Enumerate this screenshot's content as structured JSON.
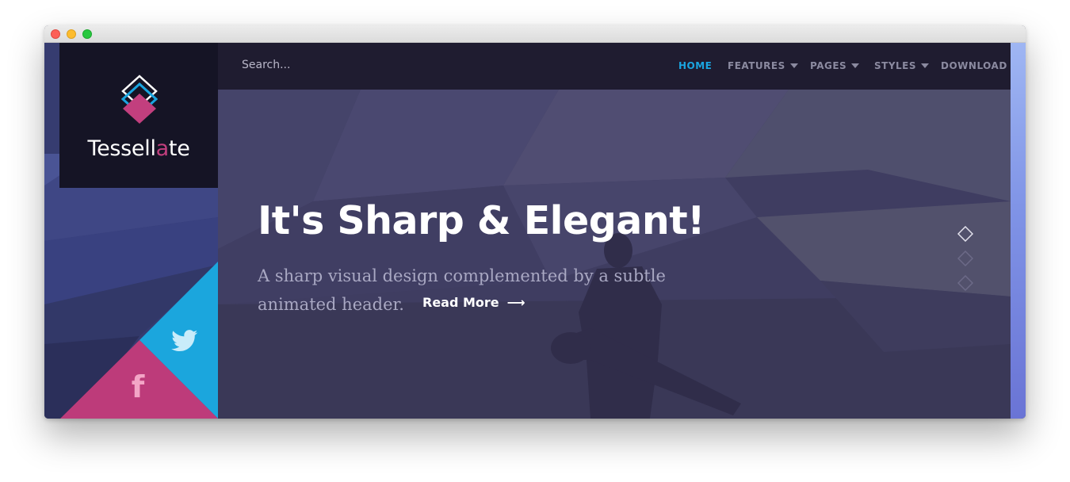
{
  "brand": {
    "name_part1": "Tessell",
    "name_accent": "a",
    "name_part2": "te",
    "accent_color": "#c23f7e"
  },
  "search": {
    "placeholder": "Search..."
  },
  "nav": {
    "items": [
      {
        "label": "HOME",
        "active": true,
        "dropdown": false
      },
      {
        "label": "FEATURES",
        "active": false,
        "dropdown": true
      },
      {
        "label": "PAGES",
        "active": false,
        "dropdown": true
      },
      {
        "label": "STYLES",
        "active": false,
        "dropdown": true
      },
      {
        "label": "DOWNLOAD",
        "active": false,
        "dropdown": false
      }
    ],
    "active_color": "#1aa5e0"
  },
  "hero": {
    "title": "It's Sharp & Elegant!",
    "subtitle_line1": "A sharp visual design complemented by a subtle",
    "subtitle_line2": "animated header.",
    "cta_label": "Read More",
    "cta_icon": "arrow-right-icon"
  },
  "slider": {
    "total_slides": 3,
    "active_index": 0
  },
  "social": [
    {
      "network": "twitter",
      "icon": "twitter-icon",
      "color": "#1ba6dd"
    },
    {
      "network": "facebook",
      "icon": "facebook-icon",
      "color": "#bd3b7a"
    }
  ]
}
